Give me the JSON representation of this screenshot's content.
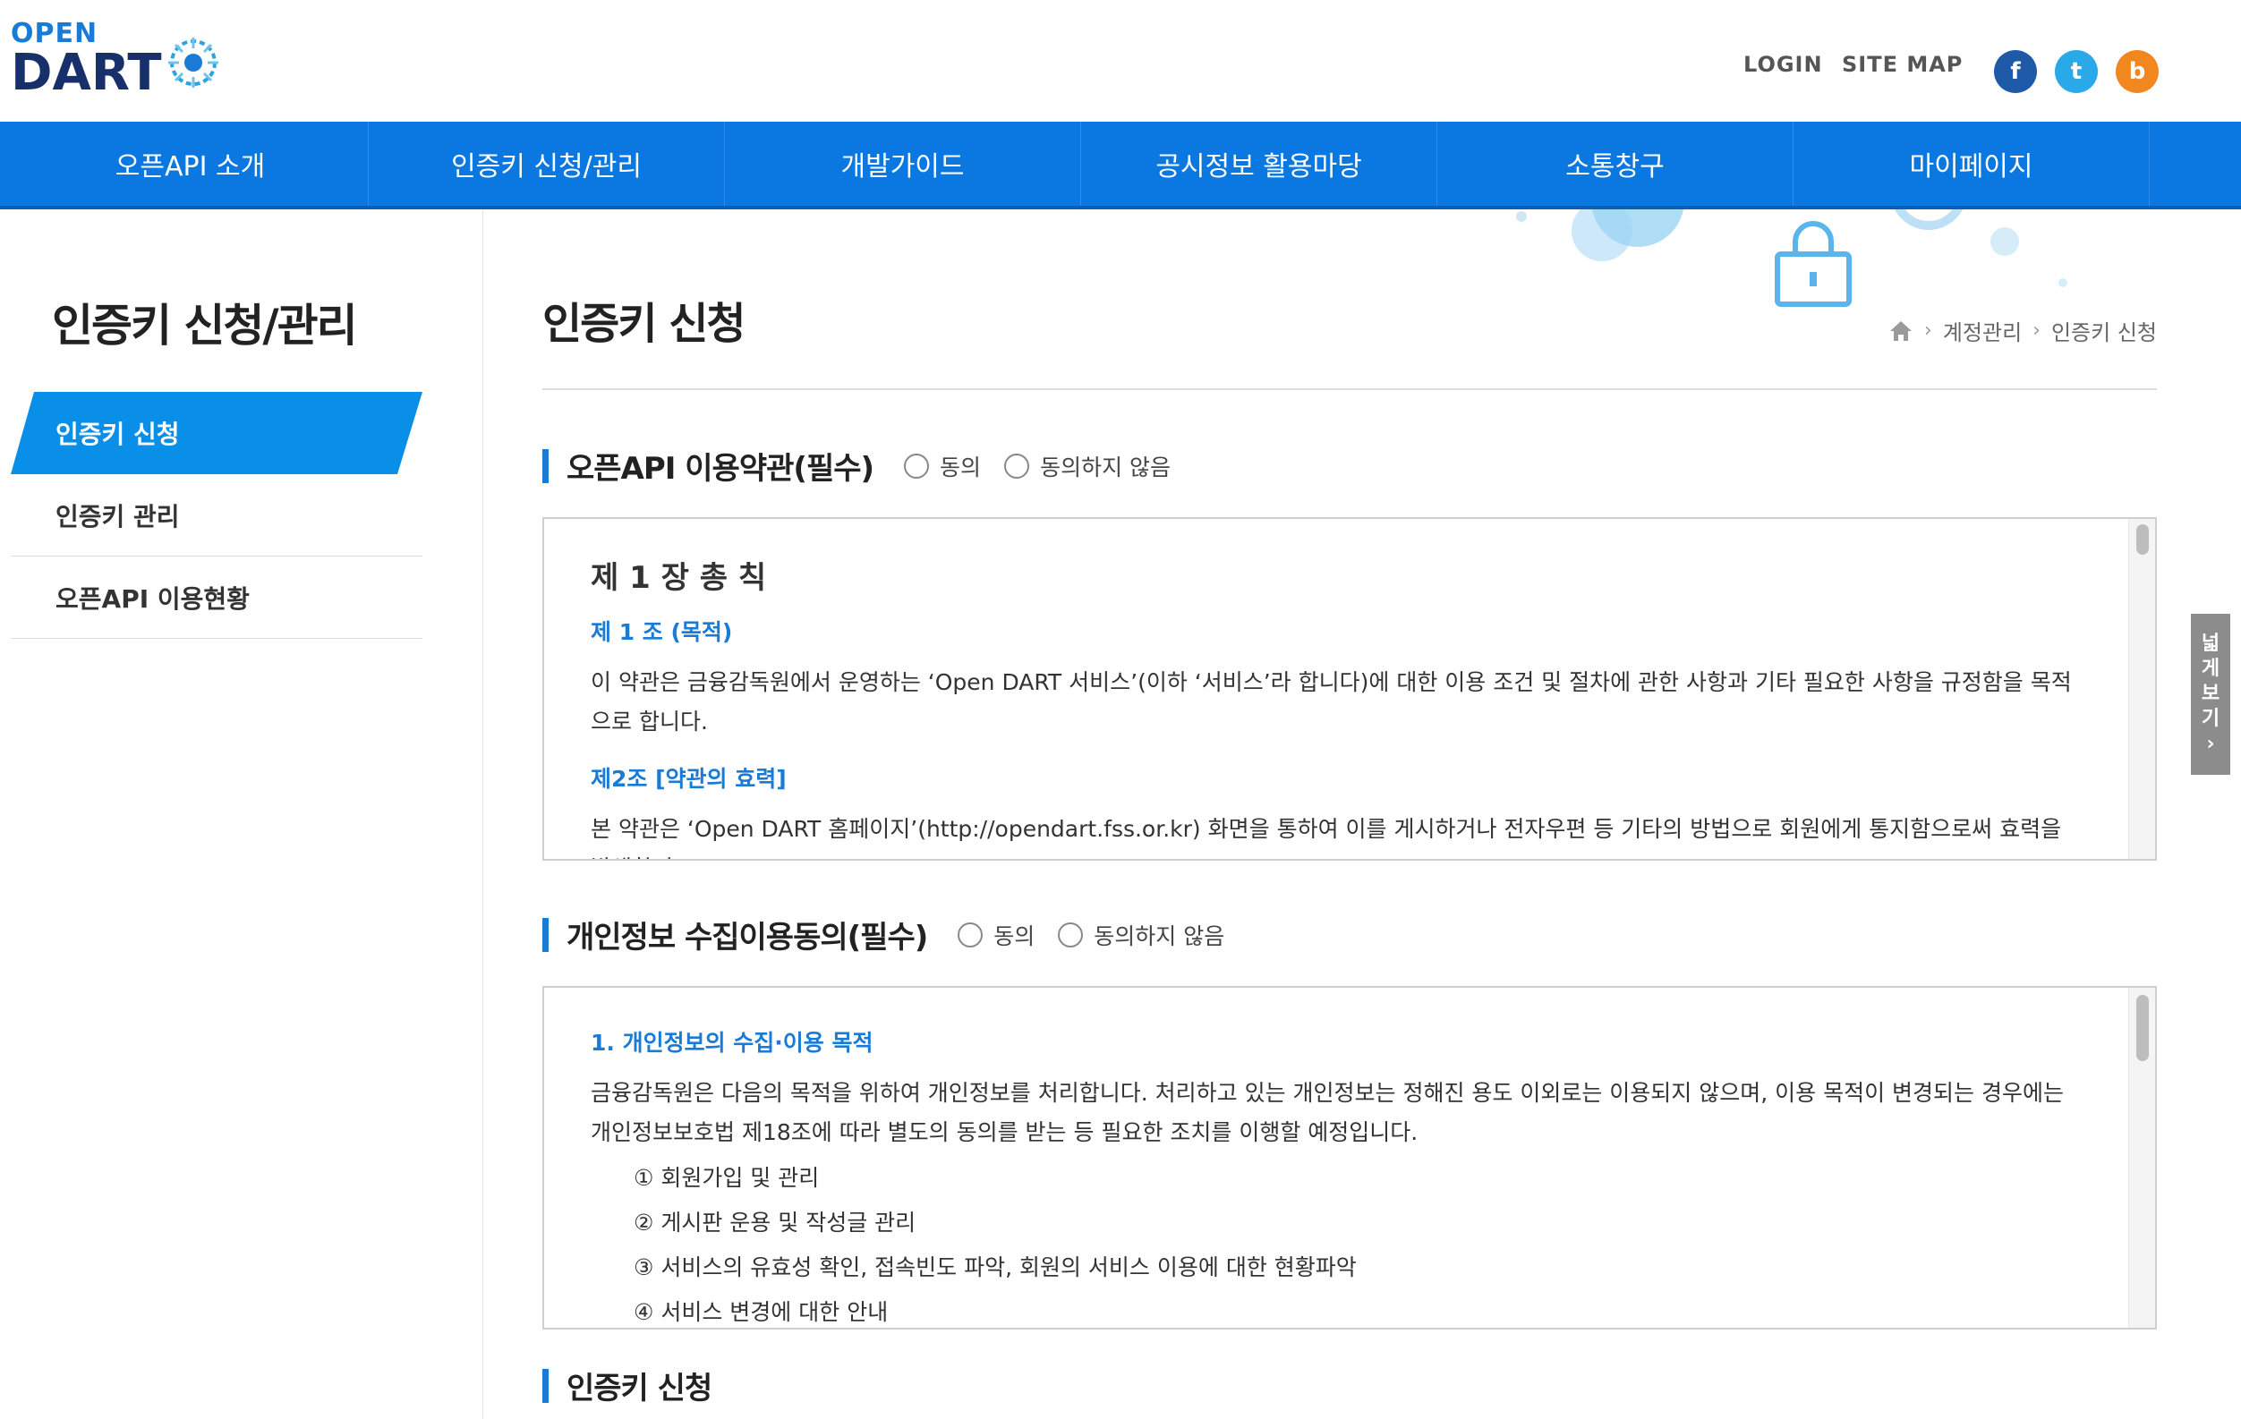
{
  "header": {
    "logo_top": "OPEN",
    "logo_main": "DART",
    "login": "LOGIN",
    "sitemap": "SITE MAP",
    "social": [
      {
        "name": "facebook-icon",
        "glyph": "f",
        "color": "#1f5aa8"
      },
      {
        "name": "twitter-icon",
        "glyph": "t",
        "color": "#2aa9e8"
      },
      {
        "name": "blogger-icon",
        "glyph": "b",
        "color": "#f2871f"
      }
    ]
  },
  "nav": {
    "items": [
      "오픈API 소개",
      "인증키 신청/관리",
      "개발가이드",
      "공시정보 활용마당",
      "소통창구",
      "마이페이지"
    ]
  },
  "sidebar": {
    "title": "인증키 신청/관리",
    "items": [
      {
        "label": "인증키 신청",
        "active": true
      },
      {
        "label": "인증키 관리",
        "active": false
      },
      {
        "label": "오픈API 이용현황",
        "active": false
      }
    ]
  },
  "content": {
    "title": "인증키 신청",
    "breadcrumb": [
      "계정관리",
      "인증키 신청"
    ],
    "terms": {
      "heading": "오픈API 이용약관(필수)",
      "agree": "동의",
      "disagree": "동의하지 않음",
      "chapter": "제 1 장 총 칙",
      "art1_title": "제 1 조 (목적)",
      "art1_body": "이 약관은 금융감독원에서 운영하는 ‘Open DART 서비스’(이하 ‘서비스’라 합니다)에 대한 이용 조건 및 절차에 관한 사항과 기타 필요한 사항을 규정함을 목적으로 합니다.",
      "art2_title": "제2조 [약관의 효력]",
      "art2_body": "본 약관은 ‘Open DART 홈페이지’(http://opendart.fss.or.kr) 화면을 통하여 이를 게시하거나 전자우편 등 기타의 방법으로 회원에게 통지함으로써 효력을 발생합니"
    },
    "privacy": {
      "heading": "개인정보 수집이용동의(필수)",
      "agree": "동의",
      "disagree": "동의하지 않음",
      "sec1_title": "1. 개인정보의 수집·이용 목적",
      "sec1_body": "금융감독원은 다음의 목적을 위하여 개인정보를 처리합니다. 처리하고 있는 개인정보는 정해진 용도 이외로는 이용되지 않으며, 이용 목적이 변경되는 경우에는 개인정보보호법 제18조에 따라 별도의 동의를 받는 등 필요한 조치를 이행할 예정입니다.",
      "list": [
        "① 회원가입 및 관리",
        "② 게시판 운용 및 작성글 관리",
        "③ 서비스의 유효성 확인, 접속빈도 파악, 회원의 서비스 이용에 대한 현황파악",
        "④ 서비스 변경에 대한 안내"
      ]
    },
    "apply_heading": "인증키 신청"
  },
  "side_tab": {
    "chars": [
      "넓",
      "게",
      "보",
      "기",
      "›"
    ]
  }
}
